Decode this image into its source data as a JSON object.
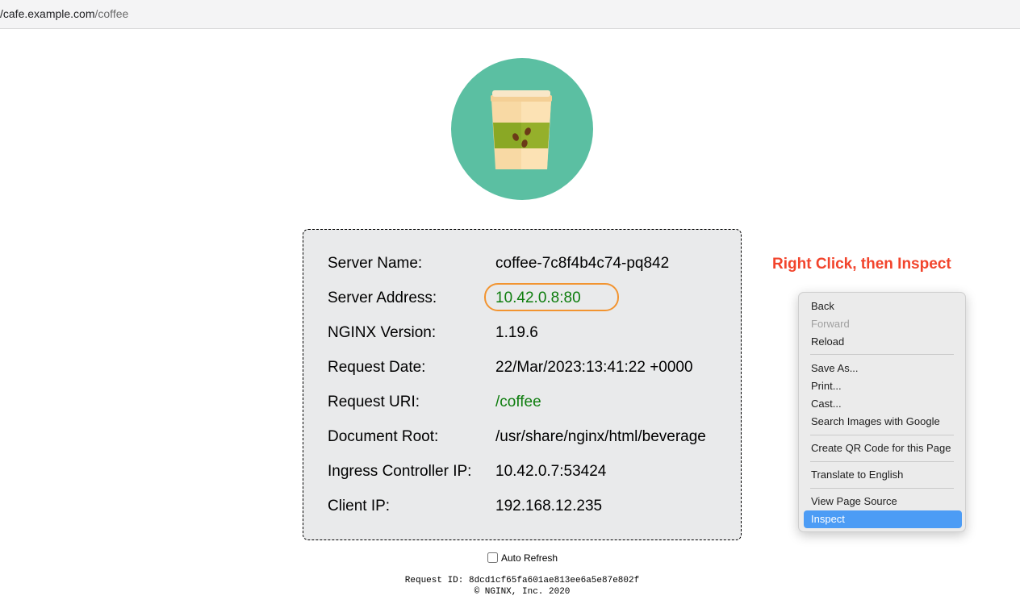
{
  "browser": {
    "url_host": "/cafe.example.com",
    "url_path": "/coffee"
  },
  "logo": {
    "icon": "coffee-cup-icon",
    "background_color": "#5bbfa2"
  },
  "info": {
    "rows": [
      {
        "label": "Server Name:",
        "value": "coffee-7c8f4b4c74-pq842"
      },
      {
        "label": "Server Address:",
        "value": "10.42.0.8:80"
      },
      {
        "label": "NGINX Version:",
        "value": "1.19.6"
      },
      {
        "label": "Request Date:",
        "value": "22/Mar/2023:13:41:22 +0000"
      },
      {
        "label": "Request URI:",
        "value": "/coffee"
      },
      {
        "label": "Document Root:",
        "value": "/usr/share/nginx/html/beverage"
      },
      {
        "label": "Ingress Controller IP:",
        "value": "10.42.0.7:53424"
      },
      {
        "label": "Client IP:",
        "value": "192.168.12.235"
      }
    ],
    "highlight_color": "#f29430",
    "value_green": "#0e7d0e"
  },
  "annotation": {
    "text": "Right Click, then Inspect",
    "color": "#f2442c"
  },
  "context_menu": {
    "items": [
      {
        "label": "Back"
      },
      {
        "label": "Forward",
        "disabled": true
      },
      {
        "label": "Reload"
      },
      {
        "label": "Save As..."
      },
      {
        "label": "Print..."
      },
      {
        "label": "Cast..."
      },
      {
        "label": "Search Images with Google"
      },
      {
        "label": "Create QR Code for this Page"
      },
      {
        "label": "Translate to English"
      },
      {
        "label": "View Page Source"
      },
      {
        "label": "Inspect",
        "selected": true
      }
    ],
    "selected_color": "#4c9cf5"
  },
  "footer": {
    "auto_refresh_label": "Auto Refresh",
    "auto_refresh_checked": false,
    "request_id": "Request ID: 8dcd1cf65fa601ae813ee6a5e87e802f",
    "copyright": "© NGINX, Inc. 2020"
  }
}
